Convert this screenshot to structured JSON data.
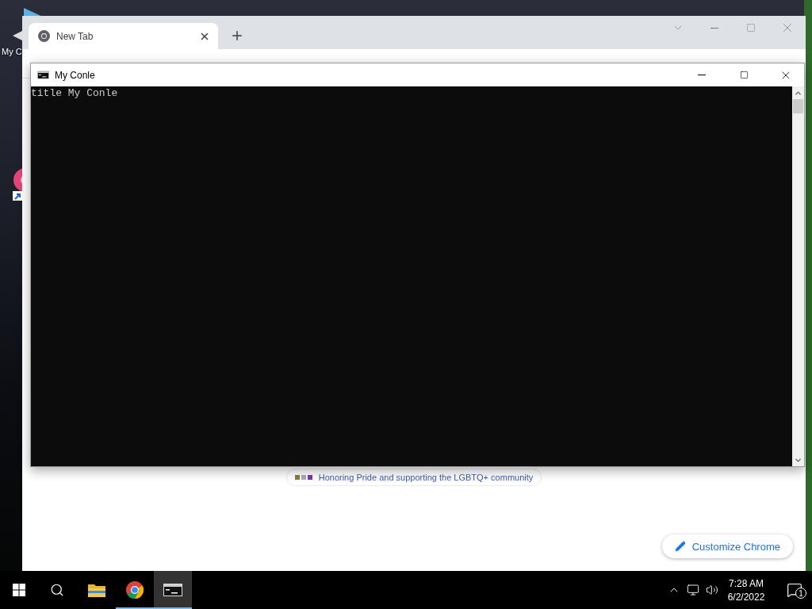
{
  "desktop": {
    "icons": [
      {
        "label": "My C"
      }
    ]
  },
  "browser": {
    "tabs": [
      {
        "label": "New Tab",
        "selected": true
      }
    ],
    "banner": {
      "text": "Honoring Pride and supporting the LGBTQ+ community"
    },
    "customize_button": {
      "label": "Customize Chrome"
    }
  },
  "console": {
    "title": "My Conle",
    "lines": [
      "title My Conle"
    ]
  },
  "taskbar": {
    "apps": [
      {
        "kind": "explorer",
        "running": false,
        "active": false
      },
      {
        "kind": "chrome",
        "running": true,
        "active": false
      },
      {
        "kind": "console",
        "running": true,
        "active": true
      }
    ],
    "clock": {
      "time": "7:28 AM",
      "date": "6/2/2022"
    },
    "notifications": {
      "count": "1"
    }
  }
}
